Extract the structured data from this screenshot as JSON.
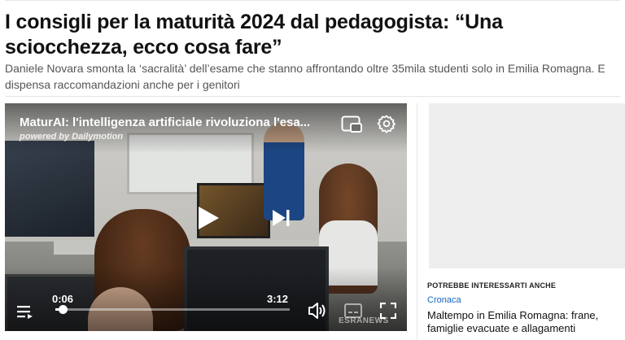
{
  "article": {
    "headline": "I consigli per la maturità 2024 dal pedagogista: “Una sciocchezza, ecco cosa fare”",
    "subtitle": "Daniele Novara smonta la ‘sacralità’ dell’esame che stanno affrontando oltre 35mila studenti solo in Emilia Romagna. E dispensa raccomandazioni anche per i genitori"
  },
  "video": {
    "title": "MaturAI: l'intelligenza artificiale rivoluziona l'esa...",
    "powered_by": "powered by Dailymotion",
    "current_time": "0:06",
    "total_time": "3:12",
    "progress_fraction": 0.031,
    "watermark": "ESRANEWS",
    "icons": {
      "play": "play-icon",
      "next": "next-icon",
      "pip": "picture-in-picture-icon",
      "settings": "gear-icon",
      "menu": "playlist-menu-icon",
      "volume": "volume-icon",
      "captions": "captions-icon",
      "fullscreen": "fullscreen-icon"
    }
  },
  "sidebar": {
    "suggest_label": "POTREBBE INTERESSARTI ANCHE",
    "section": "Cronaca",
    "related_title": "Maltempo in Emilia Romagna: frane, famiglie evacuate e allagamenti"
  },
  "colors": {
    "link": "#1565c0",
    "text": "#111111",
    "muted": "#555555"
  }
}
